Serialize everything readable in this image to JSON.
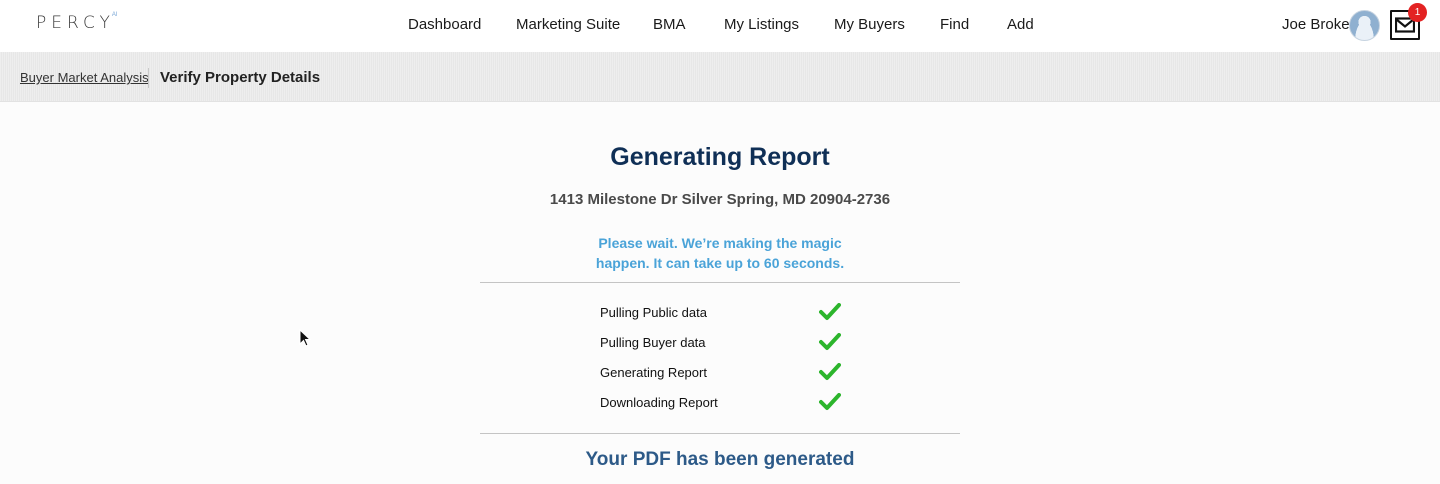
{
  "brand": {
    "logo_text": "PERCY",
    "logo_sup": "AI"
  },
  "nav": {
    "items": [
      {
        "label": "Dashboard"
      },
      {
        "label": "Marketing Suite"
      },
      {
        "label": "BMA"
      },
      {
        "label": "My Listings"
      },
      {
        "label": "My Buyers"
      },
      {
        "label": "Find"
      },
      {
        "label": "Add"
      }
    ]
  },
  "user": {
    "name": "Joe Broker",
    "notification_count": "1"
  },
  "breadcrumb": {
    "parent": "Buyer Market Analysis",
    "current": "Verify Property Details"
  },
  "report": {
    "title": "Generating Report",
    "address": "1413 Milestone Dr Silver Spring, MD 20904-2736",
    "wait_line1": "Please wait. We’re making the magic",
    "wait_line2": "happen. It can take up to 60 seconds.",
    "steps": [
      {
        "label": "Pulling Public data",
        "status": "done"
      },
      {
        "label": "Pulling Buyer data",
        "status": "done"
      },
      {
        "label": "Generating Report",
        "status": "done"
      },
      {
        "label": "Downloading Report",
        "status": "done"
      }
    ],
    "done_message": "Your PDF has been generated"
  },
  "colors": {
    "title": "#0f2f56",
    "wait": "#4aa3d8",
    "check": "#2cb52c",
    "badge": "#e32222"
  }
}
